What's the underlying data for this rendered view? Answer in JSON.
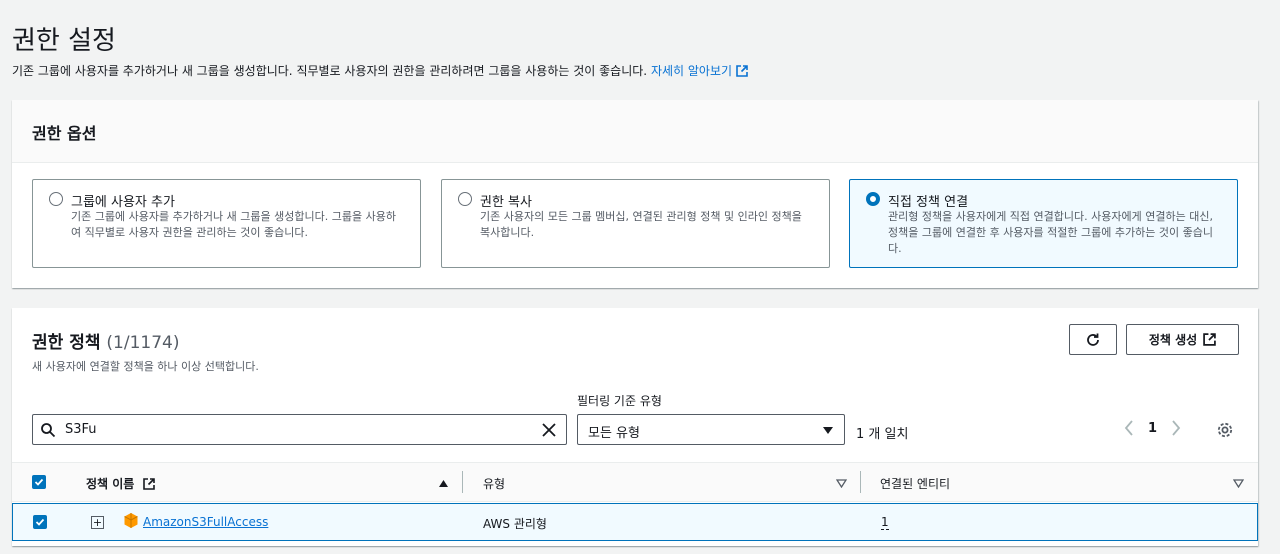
{
  "page": {
    "title": "권한 설정",
    "description": "기존 그룹에 사용자를 추가하거나 새 그룹을 생성합니다. 직무별로 사용자의 권한을 관리하려면 그룹을 사용하는 것이 좋습니다.",
    "learn_more": "자세히 알아보기"
  },
  "options_panel": {
    "title": "권한 옵션",
    "tiles": [
      {
        "title": "그룹에 사용자 추가",
        "desc": "기존 그룹에 사용자를 추가하거나 새 그룹을 생성합니다. 그룹을 사용하여 직무별로 사용자 권한을 관리하는 것이 좋습니다.",
        "selected": false
      },
      {
        "title": "권한 복사",
        "desc": "기존 사용자의 모든 그룹 멤버십, 연결된 관리형 정책 및 인라인 정책을 복사합니다.",
        "selected": false
      },
      {
        "title": "직접 정책 연결",
        "desc": "관리형 정책을 사용자에게 직접 연결합니다. 사용자에게 연결하는 대신, 정책을 그룹에 연결한 후 사용자를 적절한 그룹에 추가하는 것이 좋습니다.",
        "selected": true
      }
    ]
  },
  "policies_panel": {
    "title": "권한 정책",
    "count": "(1/1174)",
    "description": "새 사용자에 연결할 정책을 하나 이상 선택합니다.",
    "create_button": "정책 생성",
    "filter_label": "필터링 기준 유형",
    "search_value": "S3Fu",
    "filter_select": "모든 유형",
    "match_text": "1 개 일치",
    "page_number": "1",
    "columns": {
      "name": "정책 이름",
      "type": "유형",
      "entities": "연결된 엔티티"
    },
    "rows": [
      {
        "name": "AmazonS3FullAccess",
        "type": "AWS 관리형",
        "entities": "1",
        "selected": true
      }
    ]
  },
  "colors": {
    "accent": "#0073bb",
    "link": "#0972d3",
    "aws_orange": "#ff9900"
  }
}
